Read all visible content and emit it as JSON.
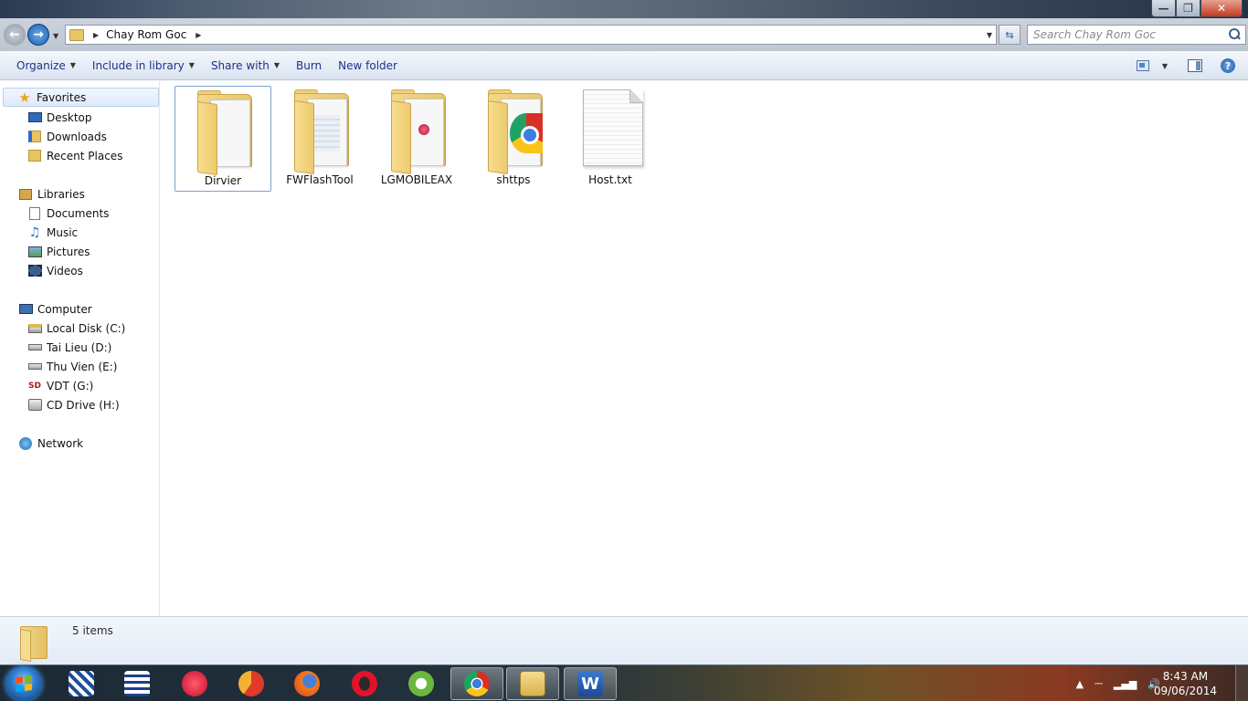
{
  "window": {
    "breadcrumb": [
      "Chay Rom Goc"
    ],
    "search_placeholder": "Search Chay Rom Goc",
    "buttons": {
      "minimize": "—",
      "maximize": "❐",
      "close": "✕"
    }
  },
  "toolbar": {
    "organize": "Organize",
    "include_in_library": "Include in library",
    "share_with": "Share with",
    "burn": "Burn",
    "new_folder": "New folder",
    "help": "?"
  },
  "navigation": {
    "favorites": {
      "label": "Favorites",
      "items": [
        "Desktop",
        "Downloads",
        "Recent Places"
      ]
    },
    "libraries": {
      "label": "Libraries",
      "items": [
        "Documents",
        "Music",
        "Pictures",
        "Videos"
      ]
    },
    "computer": {
      "label": "Computer",
      "items": [
        "Local Disk (C:)",
        "Tai Lieu (D:)",
        "Thu Vien (E:)",
        "VDT (G:)",
        "CD Drive (H:)"
      ]
    },
    "network": {
      "label": "Network"
    }
  },
  "files": [
    {
      "name": "Dirvier",
      "type": "folder"
    },
    {
      "name": "FWFlashTool",
      "type": "folder"
    },
    {
      "name": "LGMOBILEAX",
      "type": "folder"
    },
    {
      "name": "shttps",
      "type": "folder"
    },
    {
      "name": "Host.txt",
      "type": "text-file"
    }
  ],
  "details": {
    "item_count": "5 items"
  },
  "taskbar": {
    "apps": [
      "tweak-tool",
      "app-list",
      "lg-tool",
      "ccleaner",
      "firefox",
      "opera",
      "coc-coc",
      "chrome",
      "windows-explorer",
      "microsoft-word"
    ],
    "clock_time": "8:43 AM",
    "clock_date": "09/06/2014"
  },
  "colors": {
    "accent": "#1e3287",
    "selection_border": "#7da2ce",
    "folder": "#e9c66b"
  }
}
